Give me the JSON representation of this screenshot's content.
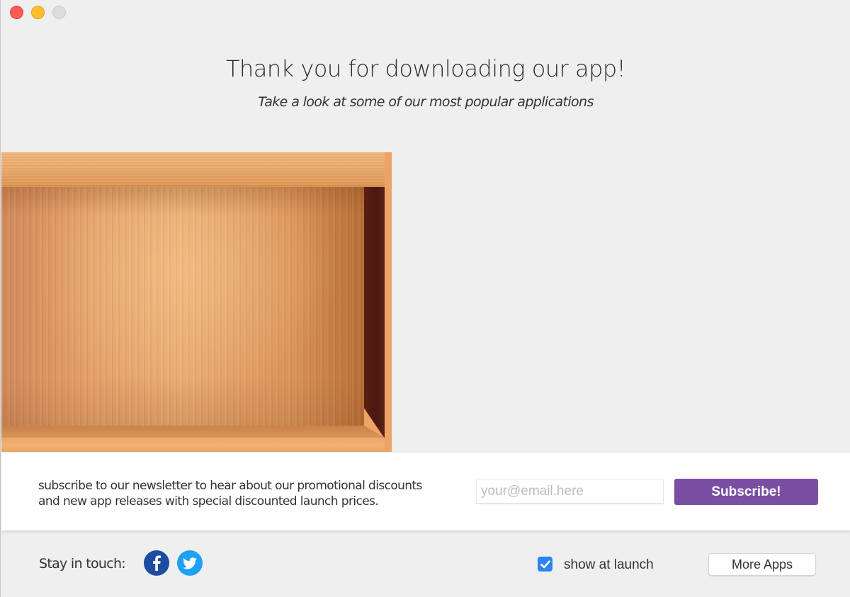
{
  "window": {
    "controls": [
      {
        "name": "close",
        "color": "#fd5c56"
      },
      {
        "name": "minimize",
        "color": "#febc2e"
      },
      {
        "name": "zoom",
        "color": "#dcdcdc"
      }
    ]
  },
  "header": {
    "title": "Thank you for downloading our app!",
    "subtitle": "Take a look at some of our most popular applications"
  },
  "showcase": {
    "type": "empty-wooden-shelf",
    "apps": []
  },
  "newsletter": {
    "text_line1": "subscribe to our newsletter to hear about our promotional discounts",
    "text_line2": "and new app releases with special discounted launch prices.",
    "email_value": "",
    "email_placeholder": "your@email.here",
    "subscribe_label": "Subscribe!",
    "accent_color": "#7a4fa3"
  },
  "footer": {
    "stay_in_touch_label": "Stay in touch:",
    "social": [
      {
        "name": "facebook",
        "icon": "facebook-icon",
        "color": "#1c4da1"
      },
      {
        "name": "twitter",
        "icon": "twitter-icon",
        "color": "#1da1f2"
      }
    ],
    "show_at_launch_label": "show at launch",
    "show_at_launch_checked": true,
    "more_apps_label": "More Apps"
  }
}
